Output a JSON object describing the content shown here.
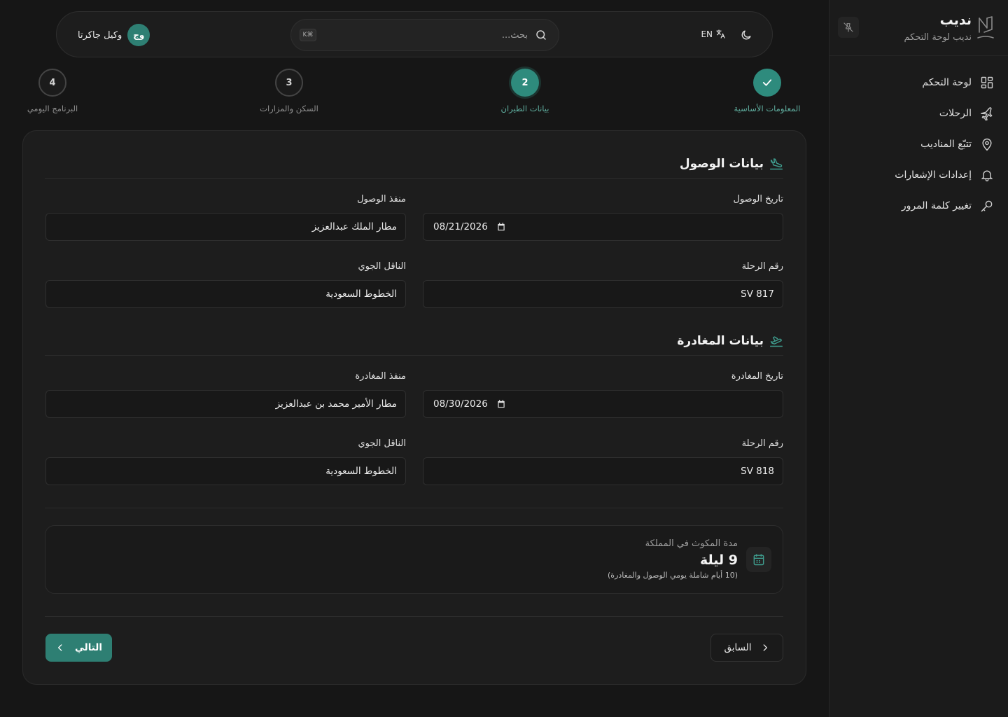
{
  "brand": {
    "title": "نديب",
    "subtitle": "نديب لوحة التحكم"
  },
  "sidebar": {
    "items": [
      {
        "label": "لوحة التحكم",
        "icon": "grid-icon"
      },
      {
        "label": "الرحلات",
        "icon": "plane-icon"
      },
      {
        "label": "تتبّع المناديب",
        "icon": "map-pin-icon"
      },
      {
        "label": "إعدادات الإشعارات",
        "icon": "bell-icon"
      },
      {
        "label": "تغيير كلمة المرور",
        "icon": "key-icon"
      }
    ]
  },
  "topbar": {
    "lang": "EN",
    "search_placeholder": "بحث...",
    "kbd": "K⌘",
    "agent_initials": "وج",
    "agent_name": "وكيل جاكرتا"
  },
  "steps": [
    {
      "label": "المعلومات الأساسية",
      "state": "done"
    },
    {
      "label": "بيانات الطيران",
      "number": "2",
      "state": "active"
    },
    {
      "label": "السكن والمزارات",
      "number": "3",
      "state": "pending"
    },
    {
      "label": "البرنامج اليومي",
      "number": "4",
      "state": "pending"
    }
  ],
  "arrival": {
    "title": "بيانات الوصول",
    "date_label": "تاريخ الوصول",
    "date_value": "08/21/2026",
    "port_label": "منفذ الوصول",
    "port_value": "مطار الملك عبدالعزيز",
    "flight_label": "رقم الرحلة",
    "flight_value": "SV 817",
    "carrier_label": "الناقل الجوي",
    "carrier_value": "الخطوط السعودية"
  },
  "departure": {
    "title": "بيانات المغادرة",
    "date_label": "تاريخ المغادرة",
    "date_value": "08/30/2026",
    "port_label": "منفذ المغادرة",
    "port_value": "مطار الأمير محمد بن عبدالعزيز",
    "flight_label": "رقم الرحلة",
    "flight_value": "SV 818",
    "carrier_label": "الناقل الجوي",
    "carrier_value": "الخطوط السعودية"
  },
  "stay": {
    "label": "مدة المكوث في المملكة",
    "value": "9 ليلة",
    "note": "(10 أيام شاملة يومي الوصول والمغادرة)"
  },
  "buttons": {
    "prev": "السابق",
    "next": "التالي"
  },
  "colors": {
    "accent": "#2e7f73",
    "background": "#161616",
    "card": "#1d1d1d"
  }
}
